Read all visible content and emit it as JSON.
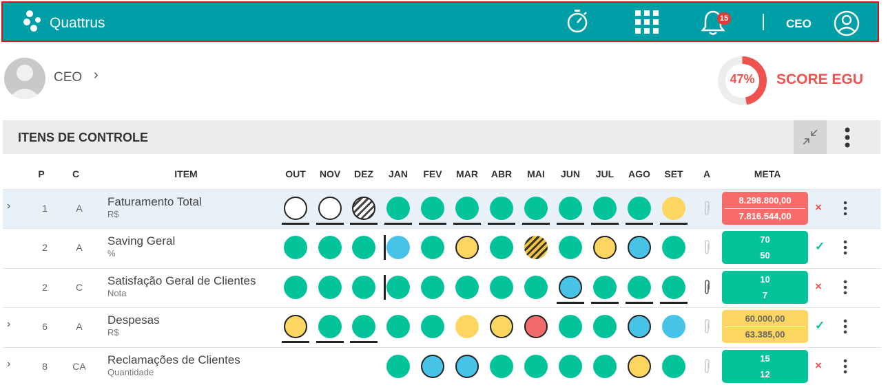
{
  "app": {
    "name": "Quattrus",
    "role": "CEO",
    "notifications": "15"
  },
  "icons": {
    "logo": "quattrus-logo",
    "timer": "stopwatch-icon",
    "apps": "apps-grid-icon",
    "bell": "bell-icon",
    "user": "user-circle-icon"
  },
  "profile": {
    "name": "CEO"
  },
  "score": {
    "percent": "47%",
    "value": 0.47,
    "label": "SCORE EGU",
    "color": "#ef5350"
  },
  "section": {
    "title": "ITENS DE CONTROLE"
  },
  "columns": {
    "p": "P",
    "c": "C",
    "item": "ITEM",
    "months": [
      "OUT",
      "NOV",
      "DEZ",
      "JAN",
      "FEV",
      "MAR",
      "ABR",
      "MAI",
      "JUN",
      "JUL",
      "AGO",
      "SET"
    ],
    "a": "A",
    "meta": "META"
  },
  "colors": {
    "green": "#03c39b",
    "blue": "#47c3e8",
    "yellow": "#fdd662",
    "red": "#f26b6b",
    "meta_red": "#f86b6b",
    "meta_green": "#03c39b",
    "meta_yellow": "#fdd662"
  },
  "rows": [
    {
      "p": "1",
      "c": "A",
      "name": "Faturamento Total",
      "unit": "R$",
      "expandable": true,
      "selected": true,
      "months": [
        "white",
        "white",
        "hatch-grey",
        "green",
        "green",
        "green",
        "green",
        "green",
        "green",
        "green",
        "green",
        "yellow"
      ],
      "ringed": [
        0,
        1,
        2
      ],
      "underlined": [
        0,
        1,
        2,
        3,
        4,
        5,
        6,
        7,
        8,
        9,
        10,
        11
      ],
      "marker": null,
      "attachment": "faded",
      "meta": [
        "8.298.800,00",
        "7.816.544,00"
      ],
      "meta_color": "red",
      "status": "×"
    },
    {
      "p": "2",
      "c": "A",
      "name": "Saving Geral",
      "unit": "%",
      "expandable": false,
      "selected": false,
      "months": [
        "green",
        "green",
        "green",
        "blue",
        "green",
        "yellow",
        "green",
        "hatch-yellow",
        "green",
        "yellow",
        "blue",
        "green"
      ],
      "ringed": [
        5,
        9,
        10
      ],
      "underlined": [],
      "marker": 3,
      "attachment": "faded",
      "meta": [
        "70",
        "50"
      ],
      "meta_color": "green",
      "status": "✓"
    },
    {
      "p": "2",
      "c": "C",
      "name": "Satisfação Geral de Clientes",
      "unit": "Nota",
      "expandable": false,
      "selected": false,
      "months": [
        "green",
        "green",
        "green",
        "green",
        "green",
        "green",
        "green",
        "green",
        "blue",
        "green",
        "green",
        "green"
      ],
      "ringed": [
        8
      ],
      "underlined": [
        8,
        9,
        10,
        11
      ],
      "marker": 3,
      "attachment": "active",
      "meta": [
        "10",
        "7"
      ],
      "meta_color": "green",
      "status": "×"
    },
    {
      "p": "6",
      "c": "A",
      "name": "Despesas",
      "unit": "R$",
      "expandable": true,
      "selected": false,
      "months": [
        "yellow",
        "green",
        "green",
        "green",
        "green",
        "yellow",
        "yellow",
        "red",
        "green",
        "green",
        "blue",
        "blue"
      ],
      "ringed": [
        0,
        6,
        7,
        10
      ],
      "underlined": [
        0,
        1,
        2
      ],
      "marker": null,
      "attachment": "faded",
      "meta": [
        "60.000,00",
        "63.385,00"
      ],
      "meta_color": "yellow",
      "status": "✓"
    },
    {
      "p": "8",
      "c": "CA",
      "name": "Reclamações de Clientes",
      "unit": "Quantidade",
      "expandable": true,
      "selected": false,
      "months": [
        null,
        null,
        null,
        "green",
        "blue",
        "blue",
        "green",
        "green",
        "green",
        "green",
        "yellow",
        "green"
      ],
      "ringed": [
        4,
        5,
        10
      ],
      "underlined": [],
      "marker": null,
      "attachment": "faded",
      "meta": [
        "15",
        "12"
      ],
      "meta_color": "green",
      "status": "×"
    }
  ]
}
